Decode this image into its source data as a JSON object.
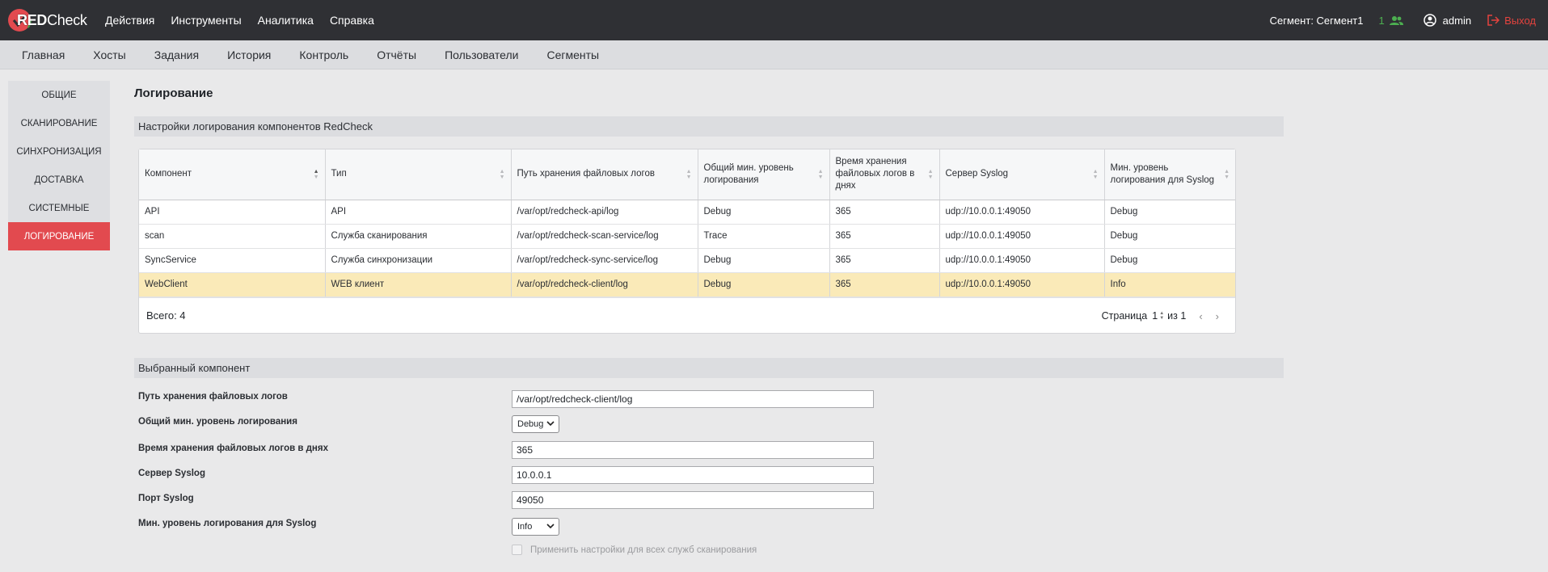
{
  "app": {
    "logo_red": "RED",
    "logo_check": "Check",
    "top_menu": [
      "Действия",
      "Инструменты",
      "Аналитика",
      "Справка"
    ],
    "segment_label": "Сегмент: Сегмент1",
    "users_count": "1",
    "user_name": "admin",
    "logout_label": "Выход",
    "accent_color": "#e24a4f"
  },
  "subnav": [
    "Главная",
    "Хосты",
    "Задания",
    "История",
    "Контроль",
    "Отчёты",
    "Пользователи",
    "Сегменты"
  ],
  "sidebar": [
    "Общие",
    "Сканирование",
    "Синхронизация",
    "Доставка",
    "Системные",
    "Логирование"
  ],
  "sidebar_active": "Логирование",
  "page_title": "Логирование",
  "section1_title": "Настройки логирования компонентов RedCheck",
  "table": {
    "columns": [
      "Компонент",
      "Тип",
      "Путь хранения файловых логов",
      "Общий мин. уровень логирования",
      "Время хранения файловых логов в днях",
      "Сервер Syslog",
      "Мин. уровень логирования для Syslog"
    ],
    "rows": [
      [
        "API",
        "API",
        "/var/opt/redcheck-api/log",
        "Debug",
        "365",
        "udp://10.0.0.1:49050",
        "Debug"
      ],
      [
        "scan",
        "Служба сканирования",
        "/var/opt/redcheck-scan-service/log",
        "Trace",
        "365",
        "udp://10.0.0.1:49050",
        "Debug"
      ],
      [
        "SyncService",
        "Служба синхронизации",
        "/var/opt/redcheck-sync-service/log",
        "Debug",
        "365",
        "udp://10.0.0.1:49050",
        "Debug"
      ],
      [
        "WebClient",
        "WEB клиент",
        "/var/opt/redcheck-client/log",
        "Debug",
        "365",
        "udp://10.0.0.1:49050",
        "Info"
      ]
    ],
    "selected_row_index": 3,
    "total_label": "Всего: 4",
    "page_label": "Страница",
    "page_value": "1",
    "page_of": "из 1"
  },
  "section2_title": "Выбранный компонент",
  "form": {
    "path_label": "Путь хранения файловых логов",
    "path_value": "/var/opt/redcheck-client/log",
    "level_label": "Общий мин. уровень логирования",
    "level_value": "Debug",
    "days_label": "Время хранения файловых логов в днях",
    "days_value": "365",
    "server_label": "Сервер Syslog",
    "server_value": "10.0.0.1",
    "port_label": "Порт Syslog",
    "port_value": "49050",
    "syslog_level_label": "Мин. уровень логирования для Syslog",
    "syslog_level_value": "Info",
    "apply_all_label": "Применить настройки для всех служб сканирования"
  }
}
